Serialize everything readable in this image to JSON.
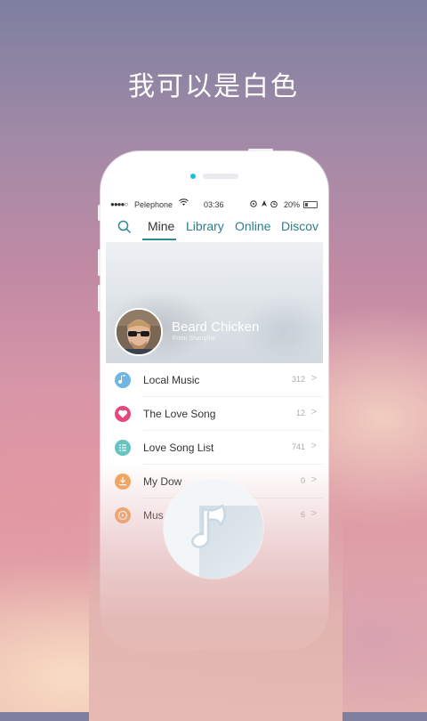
{
  "headline": "我可以是白色",
  "status_bar": {
    "signal": "●●●●○",
    "carrier": "Pelephone",
    "time": "03:36",
    "battery": "20%"
  },
  "tabs": [
    {
      "label": "Mine",
      "active": true
    },
    {
      "label": "Library",
      "active": false
    },
    {
      "label": "Online",
      "active": false
    },
    {
      "label": "Discov",
      "active": false
    }
  ],
  "profile": {
    "name": "Beard Chicken",
    "location": "From Shanghai"
  },
  "list": [
    {
      "label": "Local Music",
      "count": "312",
      "icon": "music-note-icon",
      "color": "#6fb6e2"
    },
    {
      "label": "The Love Song",
      "count": "12",
      "icon": "heart-icon",
      "color": "#e5487a"
    },
    {
      "label": "Love Song List",
      "count": "741",
      "icon": "list-icon",
      "color": "#67c2c0"
    },
    {
      "label": "My Dow",
      "count": "0",
      "icon": "download-icon",
      "color": "#f2a65a"
    },
    {
      "label": "Mus",
      "count": "6",
      "icon": "disc-icon",
      "color": "#f2a65a"
    }
  ],
  "colors": {
    "accent": "#2c8a94",
    "background_top": "#7d7f9f",
    "background_bottom": "#e7b5af"
  }
}
